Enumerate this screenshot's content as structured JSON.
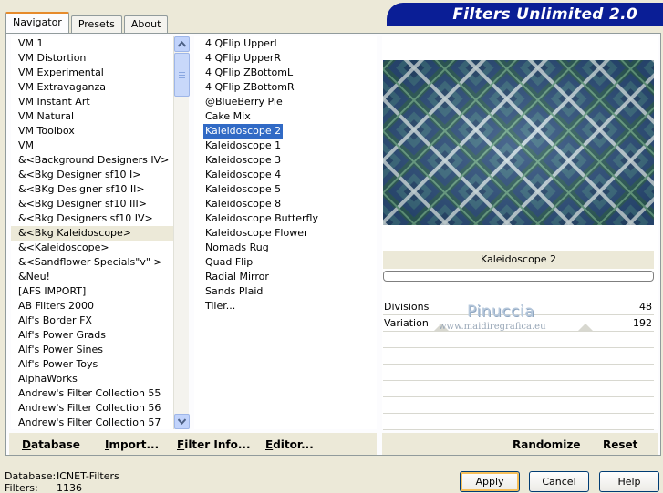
{
  "window": {
    "title": "Filters Unlimited 2.0",
    "tabs": [
      "Navigator",
      "Presets",
      "About"
    ]
  },
  "categories": [
    "VM 1",
    "VM Distortion",
    "VM Experimental",
    "VM Extravaganza",
    "VM Instant Art",
    "VM Natural",
    "VM Toolbox",
    "VM",
    "&<Background Designers IV>",
    "&<Bkg Designer sf10 I>",
    "&<BKg Designer sf10 II>",
    "&<Bkg Designer sf10 III>",
    "&<Bkg Designers sf10 IV>",
    "&<Bkg Kaleidoscope>",
    "&<Kaleidoscope>",
    "&<Sandflower Specials\"v\" >",
    "&Neu!",
    "[AFS IMPORT]",
    "AB Filters 2000",
    "Alf's Border FX",
    "Alf's Power Grads",
    "Alf's Power Sines",
    "Alf's Power Toys",
    "AlphaWorks",
    "Andrew's Filter Collection 55",
    "Andrew's Filter Collection 56",
    "Andrew's Filter Collection 57"
  ],
  "selected_category": "&<Bkg Kaleidoscope>",
  "effects": [
    "4 QFlip UpperL",
    "4 QFlip UpperR",
    "4 QFlip ZBottomL",
    "4 QFlip ZBottomR",
    "@BlueBerry Pie",
    "Cake Mix",
    "Kaleidoscope 2",
    "Kaleidoscope 1",
    "Kaleidoscope 3",
    "Kaleidoscope 4",
    "Kaleidoscope 5",
    "Kaleidoscope 8",
    "Kaleidoscope Butterfly",
    "Kaleidoscope Flower",
    "Nomads Rug",
    "Quad Flip",
    "Radial Mirror",
    "Sands Plaid",
    "Tiler..."
  ],
  "selected_effect": "Kaleidoscope 2",
  "preview": {
    "effect_name": "Kaleidoscope 2",
    "progress": 0,
    "colors": {
      "dark": "#2f5a5a",
      "blue": "#2c4f7c",
      "light": "#e8eef0",
      "green": "#4f8a72"
    }
  },
  "params": [
    {
      "label": "Divisions",
      "value": "48"
    },
    {
      "label": "Variation",
      "value": "192"
    }
  ],
  "watermark": {
    "line1": "Pinuccia",
    "line2": "www.maidiregrafica.eu"
  },
  "toolbar": {
    "database": "Database",
    "import": "Import...",
    "filter_info": "Filter Info...",
    "editor": "Editor...",
    "randomize": "Randomize",
    "reset": "Reset"
  },
  "footer": {
    "database_label": "Database:",
    "database_value": "ICNET-Filters",
    "filters_label": "Filters:",
    "filters_value": "1136"
  },
  "buttons": {
    "apply": "Apply",
    "cancel": "Cancel",
    "help": "Help"
  },
  "colors": {
    "banner": "#0a1e96",
    "selection": "#316ac5",
    "window": "#ece9d8",
    "tab_accent": "#e68b2c"
  }
}
